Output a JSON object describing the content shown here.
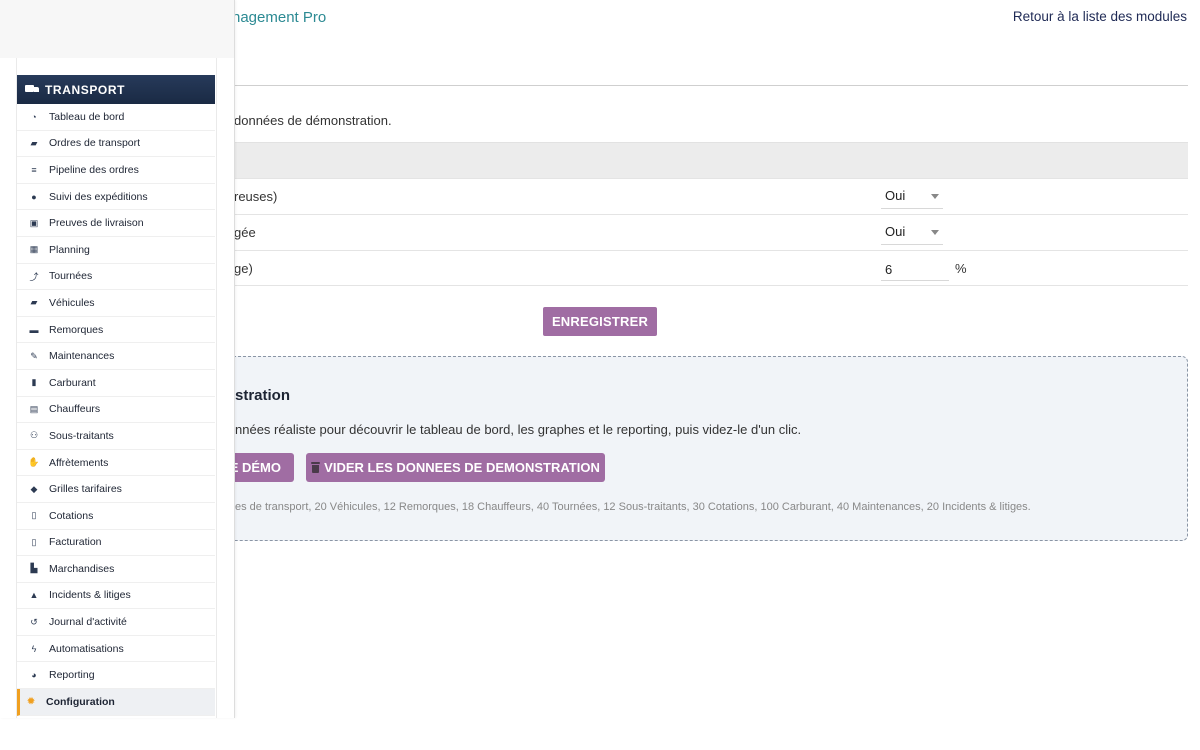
{
  "header": {
    "app_title_tail": "nagement Pro",
    "back_link": "Retour à la liste des modules"
  },
  "intro": {
    "text": "données de démonstration."
  },
  "settings": {
    "rows": [
      {
        "label": "reuses)",
        "value": "Oui"
      },
      {
        "label": "gée",
        "value": "Oui"
      },
      {
        "label": "ge)",
        "value": "6",
        "unit": "%"
      }
    ],
    "save_label": "ENREGISTRER"
  },
  "demo": {
    "title": "stration",
    "description": "nnées réaliste pour découvrir le tableau de bord, les graphes et le reporting, puis videz-le d'un clic.",
    "load_label": "E DÉMO",
    "clear_label": "VIDER LES DONNEES DE DEMONSTRATION",
    "note": "es de transport, 20 Véhicules, 12 Remorques, 18 Chauffeurs, 40 Tournées, 12 Sous-traitants, 30 Cotations, 100 Carburant, 40 Maintenances, 20 Incidents & litiges."
  },
  "sidebar": {
    "header": "TRANSPORT",
    "header_icon": "truck-icon",
    "items": [
      {
        "label": "Tableau de bord",
        "icon": "gauge-icon",
        "glyph": "◔"
      },
      {
        "label": "Ordres de transport",
        "icon": "truck-loading-icon",
        "glyph": "▰"
      },
      {
        "label": "Pipeline des ordres",
        "icon": "bars-icon",
        "glyph": "≡"
      },
      {
        "label": "Suivi des expéditions",
        "icon": "map-marker-icon",
        "glyph": "●"
      },
      {
        "label": "Preuves de livraison",
        "icon": "clipboard-check-icon",
        "glyph": "▣"
      },
      {
        "label": "Planning",
        "icon": "calendar-icon",
        "glyph": "▦"
      },
      {
        "label": "Tournées",
        "icon": "route-icon",
        "glyph": "⤴"
      },
      {
        "label": "Véhicules",
        "icon": "truck-icon",
        "glyph": "▰"
      },
      {
        "label": "Remorques",
        "icon": "trailer-icon",
        "glyph": "▬"
      },
      {
        "label": "Maintenances",
        "icon": "wrench-icon",
        "glyph": "✎"
      },
      {
        "label": "Carburant",
        "icon": "gas-pump-icon",
        "glyph": "▮"
      },
      {
        "label": "Chauffeurs",
        "icon": "id-card-icon",
        "glyph": "▤"
      },
      {
        "label": "Sous-traitants",
        "icon": "people-carry-icon",
        "glyph": "⚇"
      },
      {
        "label": "Affrètements",
        "icon": "handshake-icon",
        "glyph": "✋"
      },
      {
        "label": "Grilles tarifaires",
        "icon": "tags-icon",
        "glyph": "◆"
      },
      {
        "label": "Cotations",
        "icon": "file-invoice-icon",
        "glyph": "▯"
      },
      {
        "label": "Facturation",
        "icon": "file-invoice-dollar-icon",
        "glyph": "▯"
      },
      {
        "label": "Marchandises",
        "icon": "boxes-icon",
        "glyph": "▙"
      },
      {
        "label": "Incidents & litiges",
        "icon": "warning-icon",
        "glyph": "▲"
      },
      {
        "label": "Journal d'activité",
        "icon": "history-icon",
        "glyph": "↺"
      },
      {
        "label": "Automatisations",
        "icon": "bolt-icon",
        "glyph": "ϟ"
      },
      {
        "label": "Reporting",
        "icon": "chart-pie-icon",
        "glyph": "◕"
      },
      {
        "label": "Configuration",
        "icon": "gear-icon",
        "glyph": "✹",
        "active": true
      }
    ]
  },
  "colors": {
    "accent": "#a06da3",
    "sidebar_header": "#1f2f4b",
    "active_marker": "#f0a020",
    "link": "#2c8a93"
  }
}
